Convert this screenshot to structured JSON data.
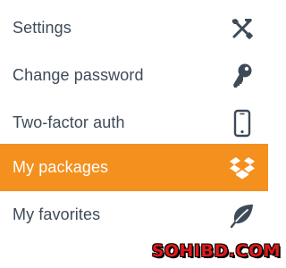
{
  "menu": {
    "items": [
      {
        "label": "Settings",
        "icon": "tools-icon",
        "active": false
      },
      {
        "label": "Change password",
        "icon": "key-icon",
        "active": false
      },
      {
        "label": "Two-factor auth",
        "icon": "phone-icon",
        "active": false
      },
      {
        "label": "My packages",
        "icon": "dropbox-icon",
        "active": true
      },
      {
        "label": "My favorites",
        "icon": "leaf-icon",
        "active": false
      }
    ]
  },
  "colors": {
    "accent": "#f4901e",
    "text": "#3e4a59",
    "active_text": "#ffffff",
    "watermark": "#e0191b"
  },
  "watermark": {
    "text": "SOHIBD.COM"
  }
}
